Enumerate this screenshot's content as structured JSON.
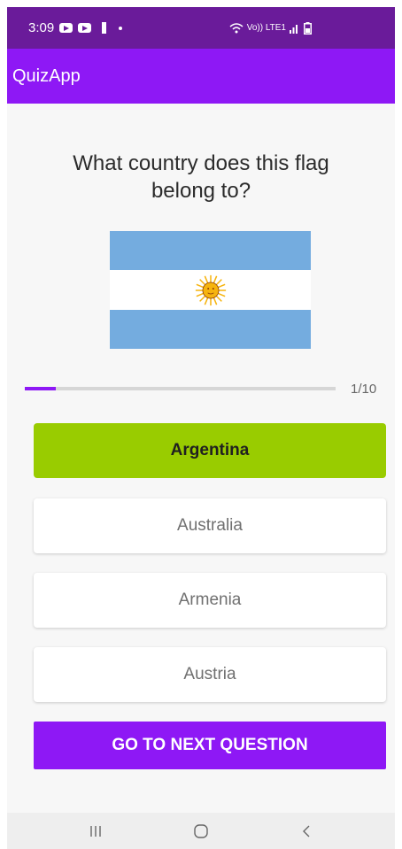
{
  "status_bar": {
    "time": "3:09",
    "signal_text": "Vo)) LTE1"
  },
  "app_bar": {
    "title": "QuizApp"
  },
  "quiz": {
    "question": "What country does this flag belong to?",
    "flag_image": "flag of Argentina",
    "progress_fraction": 0.1,
    "progress_label": "1/10",
    "options": [
      {
        "label": "Argentina",
        "state": "correct"
      },
      {
        "label": "Australia",
        "state": "default"
      },
      {
        "label": "Armenia",
        "state": "default"
      },
      {
        "label": "Austria",
        "state": "default"
      }
    ],
    "next_button_label": "GO TO NEXT QUESTION"
  },
  "colors": {
    "status_bar": "#6a1b9a",
    "primary": "#8e18f5",
    "correct_answer": "#99cc00",
    "flag_blue": "#74acdf"
  },
  "icons": [
    "youtube-icon",
    "flashlight-icon",
    "wifi-calling-icon",
    "signal-icon",
    "battery-icon",
    "recent-apps-icon",
    "home-icon",
    "back-icon"
  ]
}
